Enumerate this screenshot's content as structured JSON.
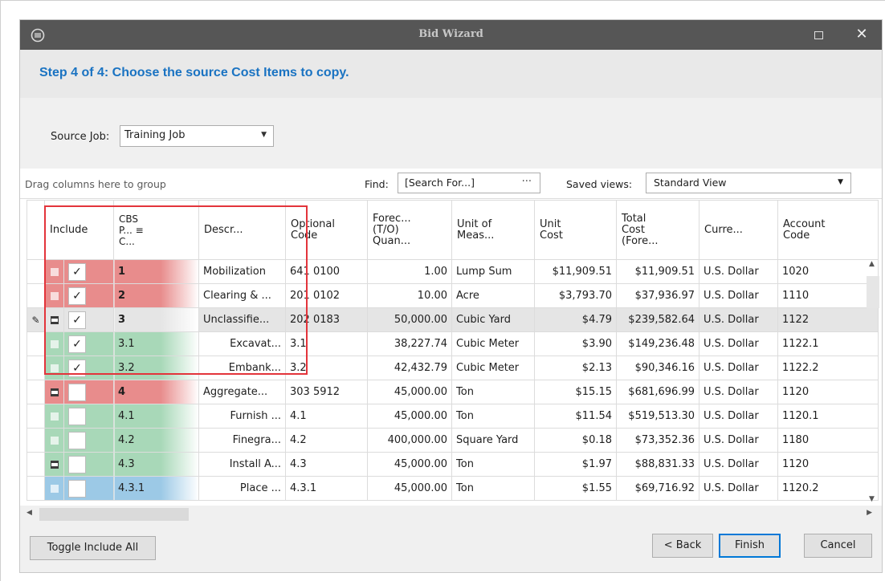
{
  "window": {
    "title": "Bid Wizard"
  },
  "step": {
    "text": "Step 4 of 4: Choose the source Cost Items to copy."
  },
  "source_job": {
    "label": "Source Job:",
    "value": "Training Job"
  },
  "toolbar": {
    "group_hint": "Drag columns here to group",
    "find_label": "Find:",
    "find_placeholder": "[Search For...]",
    "find_button": "···",
    "saved_views_label": "Saved views:",
    "saved_views_value": "Standard View"
  },
  "columns": {
    "include": "Include",
    "cbs": "CBS\nP...  ≡\nC...",
    "description": "Descr...",
    "optional_code": "Optional\nCode",
    "forecast_qty": "Forec...\n(T/O)\nQuan...",
    "uom": "Unit of\nMeas...",
    "unit_cost": "Unit\nCost",
    "total_cost": "Total\nCost\n(Fore...",
    "currency": "Curre...",
    "account_code": "Account\nCode"
  },
  "rows": [
    {
      "expander": "plus",
      "checked": "✓",
      "cbs": "1",
      "level": 0,
      "description": "Mobilization",
      "optional_code": "641 0100",
      "qty": "1.00",
      "uom": "Lump Sum",
      "unit_cost": "$11,909.51",
      "total_cost": "$11,909.51",
      "currency": "U.S. Dollar",
      "account": "1020",
      "color": "#e88c8c"
    },
    {
      "expander": "plus",
      "checked": "✓",
      "cbs": "2",
      "level": 0,
      "description": "Clearing & ...",
      "optional_code": "201 0102",
      "qty": "10.00",
      "uom": "Acre",
      "unit_cost": "$3,793.70",
      "total_cost": "$37,936.97",
      "currency": "U.S. Dollar",
      "account": "1110",
      "color": "#e88c8c"
    },
    {
      "expander": "minus",
      "checked": "✓",
      "cbs": "3",
      "level": 0,
      "description": "Unclassifie...",
      "optional_code": "202 0183",
      "qty": "50,000.00",
      "uom": "Cubic Yard",
      "unit_cost": "$4.79",
      "total_cost": "$239,582.64",
      "currency": "U.S. Dollar",
      "account": "1122",
      "color": "#e5e5e5"
    },
    {
      "expander": "plus",
      "checked": "✓",
      "cbs": "3.1",
      "level": 1,
      "description": "Excavat...",
      "optional_code": "3.1",
      "qty": "38,227.74",
      "uom": "Cubic Meter",
      "unit_cost": "$3.90",
      "total_cost": "$149,236.48",
      "currency": "U.S. Dollar",
      "account": "1122.1",
      "color": "#a8d8b8"
    },
    {
      "expander": "plus",
      "checked": "✓",
      "cbs": "3.2",
      "level": 1,
      "description": "Embank...",
      "optional_code": "3.2",
      "qty": "42,432.79",
      "uom": "Cubic Meter",
      "unit_cost": "$2.13",
      "total_cost": "$90,346.16",
      "currency": "U.S. Dollar",
      "account": "1122.2",
      "color": "#a8d8b8"
    },
    {
      "expander": "minus",
      "checked": "",
      "cbs": "4",
      "level": 0,
      "description": "Aggregate...",
      "optional_code": "303 5912",
      "qty": "45,000.00",
      "uom": "Ton",
      "unit_cost": "$15.15",
      "total_cost": "$681,696.99",
      "currency": "U.S. Dollar",
      "account": "1120",
      "color": "#e88c8c"
    },
    {
      "expander": "plus",
      "checked": "",
      "cbs": "4.1",
      "level": 1,
      "description": "Furnish ...",
      "optional_code": "4.1",
      "qty": "45,000.00",
      "uom": "Ton",
      "unit_cost": "$11.54",
      "total_cost": "$519,513.30",
      "currency": "U.S. Dollar",
      "account": "1120.1",
      "color": "#a8d8b8"
    },
    {
      "expander": "plus",
      "checked": "",
      "cbs": "4.2",
      "level": 1,
      "description": "Finegra...",
      "optional_code": "4.2",
      "qty": "400,000.00",
      "uom": "Square Yard",
      "unit_cost": "$0.18",
      "total_cost": "$73,352.36",
      "currency": "U.S. Dollar",
      "account": "1180",
      "color": "#a8d8b8"
    },
    {
      "expander": "minus",
      "checked": "",
      "cbs": "4.3",
      "level": 1,
      "description": "Install A...",
      "optional_code": "4.3",
      "qty": "45,000.00",
      "uom": "Ton",
      "unit_cost": "$1.97",
      "total_cost": "$88,831.33",
      "currency": "U.S. Dollar",
      "account": "1120",
      "color": "#a8d8b8"
    },
    {
      "expander": "plus",
      "checked": "",
      "cbs": "4.3.1",
      "level": 2,
      "description": "Place ...",
      "optional_code": "4.3.1",
      "qty": "45,000.00",
      "uom": "Ton",
      "unit_cost": "$1.55",
      "total_cost": "$69,716.92",
      "currency": "U.S. Dollar",
      "account": "1120.2",
      "color": "#9cc9e6"
    }
  ],
  "buttons": {
    "toggle_include_all": "Toggle Include All",
    "back": "< Back",
    "finish": "Finish",
    "cancel": "Cancel"
  },
  "colors": {
    "accent": "#1a73c2",
    "highlight_box": "#e3343b",
    "titlebar": "#565656"
  }
}
